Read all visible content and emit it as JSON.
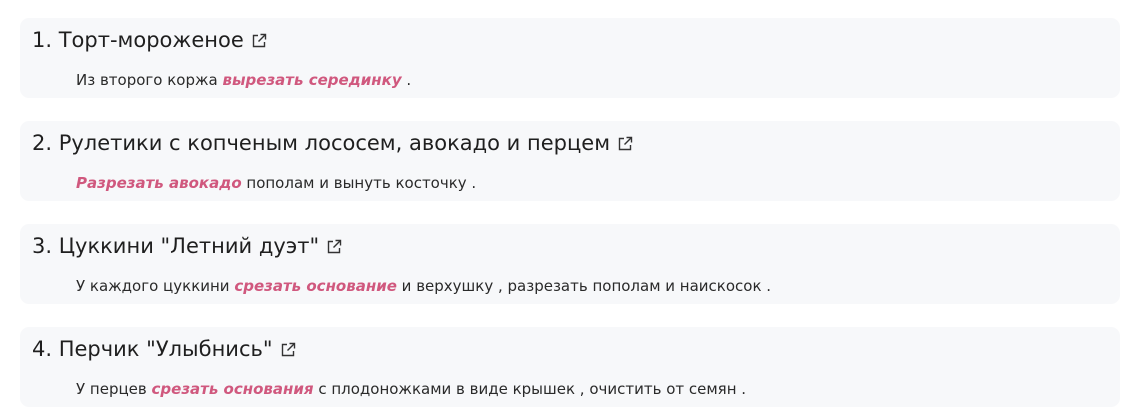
{
  "colors": {
    "card_background": "#f7f8fa",
    "text": "#1f1f1f",
    "highlight": "#d0587e"
  },
  "items": [
    {
      "title": "1. Торт-мороженое",
      "icon": "external-link-icon",
      "desc": {
        "before": "Из второго коржа ",
        "highlight": "вырезать серединку",
        "after": " ."
      }
    },
    {
      "title": "2. Рулетики с копченым лососем, авокадо и перцем",
      "icon": "external-link-icon",
      "desc": {
        "before": "",
        "highlight": "Разрезать авокадо",
        "after": " пополам и вынуть косточку ."
      }
    },
    {
      "title": "3. Цуккини \"Летний дуэт\"",
      "icon": "external-link-icon",
      "desc": {
        "before": "У каждого цуккини ",
        "highlight": "срезать основание",
        "after": " и верхушку , разрезать пополам и наискосок ."
      }
    },
    {
      "title": "4. Перчик \"Улыбнись\"",
      "icon": "external-link-icon",
      "desc": {
        "before": "У перцев ",
        "highlight": "срезать основания",
        "after": " с плодоножками в виде крышек , очистить от семян ."
      }
    }
  ]
}
